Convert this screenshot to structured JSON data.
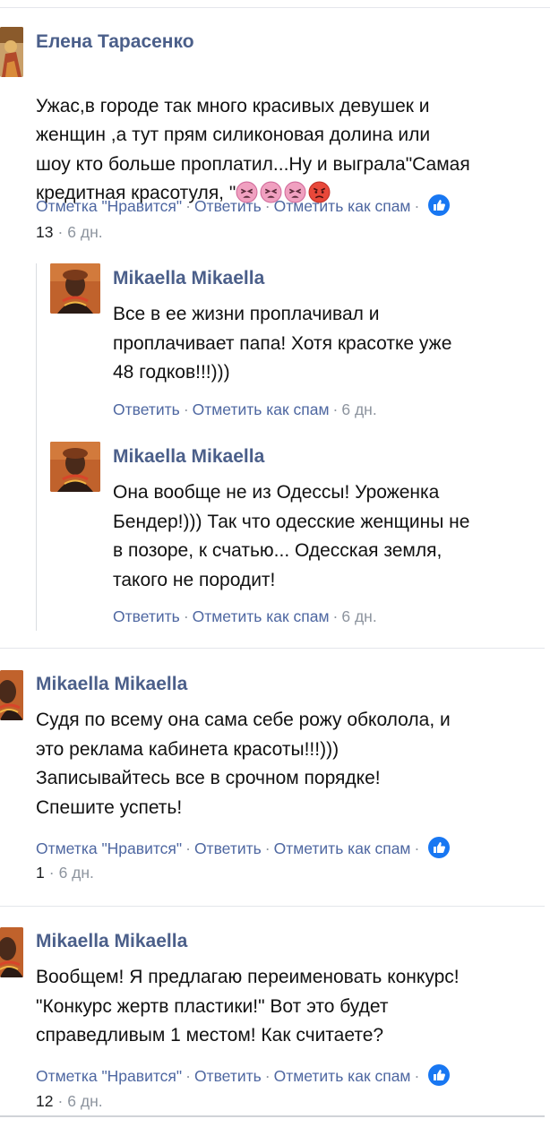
{
  "comments": [
    {
      "author": "Елена Тарасенко",
      "text": "Ужас,в городе так много красивых девушек и\nженщин ,а тут прям силиконовая долина или\nшоу кто больше проплатил...Ну и выграла\"Самая\nкредитная красотуля, \"",
      "emoji_icons": [
        "tired-face-emoji",
        "tired-face-emoji",
        "tired-face-emoji",
        "angry-face-emoji"
      ],
      "like_label": "Отметка \"Нравится\"",
      "reply_label": "Ответить",
      "spam_label": "Отметить как спам",
      "reaction_count": "13",
      "time": "6 дн.",
      "replies": [
        {
          "author": "Mikaella Mikaella",
          "text": "Все в ее жизни проплачивал и\nпроплачивает папа! Хотя красотке уже\n48 годков!!!)))",
          "reply_label": "Ответить",
          "spam_label": "Отметить как спам",
          "time": "6 дн."
        },
        {
          "author": "Mikaella Mikaella",
          "text": "Она вообще не из Одессы! Уроженка\nБендер!))) Так что одесские женщины не\nв позоре, к счатью... Одесская земля,\nтакого не породит!",
          "reply_label": "Ответить",
          "spam_label": "Отметить как спам",
          "time": "6 дн."
        }
      ]
    },
    {
      "author": "Mikaella Mikaella",
      "text": "Судя по всему она сама себе рожу обколола, и\nэто реклама кабинета красоты!!!)))\nЗаписывайтесь все в срочном порядке!\nСпешите успеть!",
      "like_label": "Отметка \"Нравится\"",
      "reply_label": "Ответить",
      "spam_label": "Отметить как спам",
      "reaction_count": "1",
      "time": "6 дн."
    },
    {
      "author": "Mikaella Mikaella",
      "text": "Вообщем! Я предлагаю переименовать конкурс!\n\"Конкурс жертв пластики!\" Вот это будет\nсправедливым 1 местом! Как считаете?",
      "like_label": "Отметка \"Нравится\"",
      "reply_label": "Ответить",
      "spam_label": "Отметить как спам",
      "reaction_count": "12",
      "time": "6 дн."
    }
  ],
  "icons": {
    "like_badge": "like-thumb-icon",
    "avatar_1": "avatar-painting",
    "avatar_2": "avatar-portrait"
  },
  "colors": {
    "author": "#4b5f8a",
    "link": "#4e67a1",
    "muted": "#8d949e",
    "like_badge": "#1877f2",
    "divider": "#e4e6eb"
  }
}
